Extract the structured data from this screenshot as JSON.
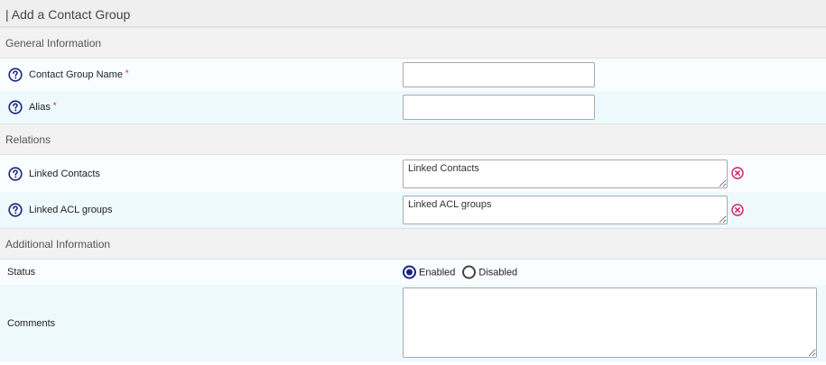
{
  "page": {
    "title": "| Add a Contact Group"
  },
  "sections": {
    "general": "General Information",
    "relations": "Relations",
    "additional": "Additional Information"
  },
  "fields": {
    "contact_group_name": {
      "label": "Contact Group Name",
      "required_mark": "*",
      "value": ""
    },
    "alias": {
      "label": "Alias",
      "required_mark": "*",
      "value": ""
    },
    "linked_contacts": {
      "label": "Linked Contacts",
      "placeholder": "Linked Contacts"
    },
    "linked_acl_groups": {
      "label": "Linked ACL groups",
      "placeholder": "Linked ACL groups"
    },
    "status": {
      "label": "Status",
      "options": [
        "Enabled",
        "Disabled"
      ],
      "selected": "Enabled"
    },
    "comments": {
      "label": "Comments",
      "value": ""
    }
  },
  "icons": {
    "help": "help-circle-icon",
    "clear": "clear-circle-icon"
  },
  "colors": {
    "help_icon": "#1a237e",
    "clear_icon": "#d81b60",
    "required": "#d0021b"
  }
}
